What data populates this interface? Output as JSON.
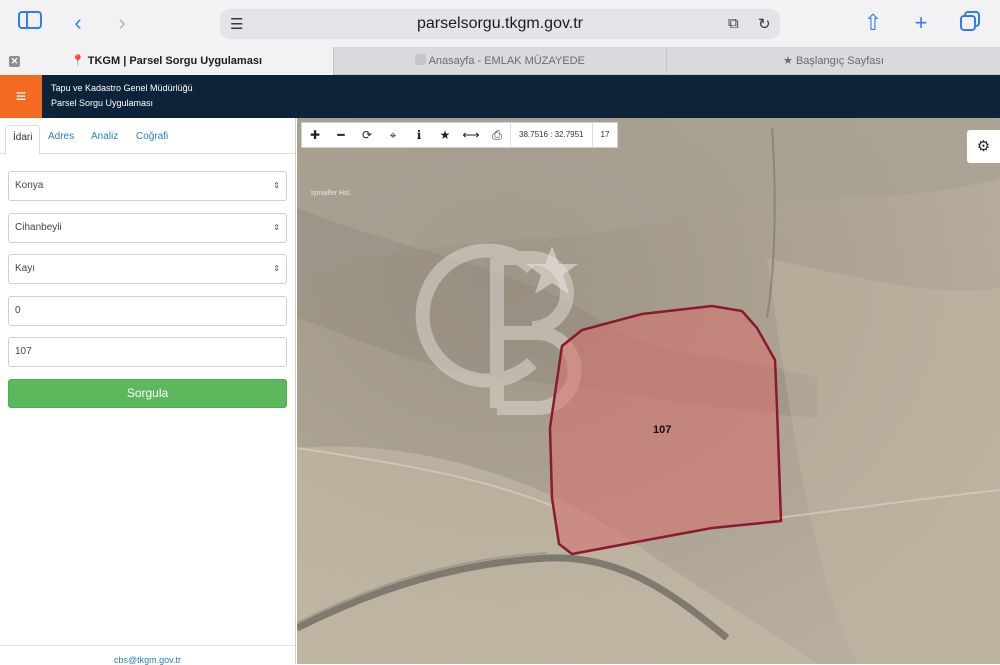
{
  "browser": {
    "url": "parselsorgu.tkgm.gov.tr",
    "tabs": [
      {
        "label": "TKGM | Parsel Sorgu Uygulaması",
        "active": true
      },
      {
        "label": "Anasayfa - EMLAK MÜZAYEDE",
        "active": false
      },
      {
        "label": "Başlangıç Sayfası",
        "active": false
      }
    ]
  },
  "header": {
    "org_name": "Tapu ve Kadastro Genel Müdürlüğü",
    "app_name": "Parsel Sorgu Uygulaması",
    "brand_color": "#0d2438",
    "menu_color": "#f26b21"
  },
  "panel": {
    "tabs": [
      "İdari",
      "Adres",
      "Analiz",
      "Coğrafi"
    ],
    "active_tab": "İdari",
    "province": "Konya",
    "district": "Cihanbeyli",
    "neighborhood": "Kayı",
    "block_no": "0",
    "parcel_no": "107",
    "submit_label": "Sorgula",
    "footer_email": "cbs@tkgm.gov.tr"
  },
  "map": {
    "coordinates": "38.7516 : 32.7951",
    "zoom": "17",
    "parcel_label": "107",
    "hill_label": "Işmailler Hsl.",
    "parcel_fill": "#d9706c",
    "parcel_stroke": "#8a1a2e"
  }
}
